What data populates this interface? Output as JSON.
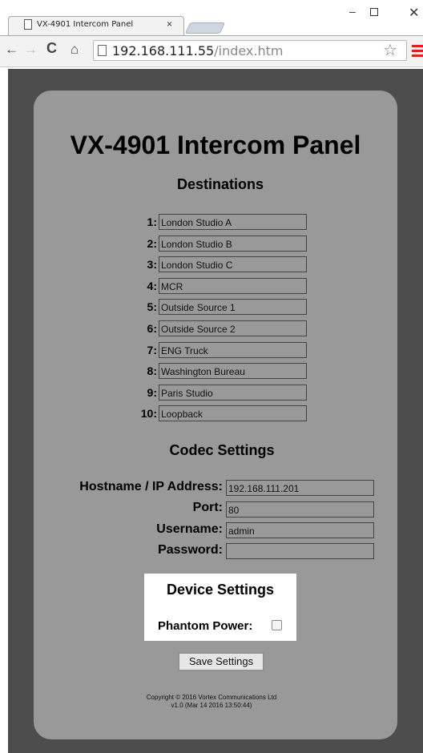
{
  "browser": {
    "tab_title": "VX-4901 Intercom Panel",
    "tab_close": "×",
    "url_host": "192.168.111.55",
    "url_path": "/index.htm"
  },
  "page": {
    "title": "VX-4901 Intercom Panel",
    "destinations_heading": "Destinations",
    "destinations": [
      {
        "num": "1:",
        "value": "London Studio A"
      },
      {
        "num": "2:",
        "value": "London Studio B"
      },
      {
        "num": "3:",
        "value": "London Studio C"
      },
      {
        "num": "4:",
        "value": "MCR"
      },
      {
        "num": "5:",
        "value": "Outside Source 1"
      },
      {
        "num": "6:",
        "value": "Outside Source 2"
      },
      {
        "num": "7:",
        "value": "ENG Truck"
      },
      {
        "num": "8:",
        "value": "Washington Bureau"
      },
      {
        "num": "9:",
        "value": "Paris Studio"
      },
      {
        "num": "10:",
        "value": "Loopback"
      }
    ],
    "codec_heading": "Codec Settings",
    "codec": {
      "hostname_label": "Hostname / IP Address:",
      "hostname_value": "192.168.111.201",
      "port_label": "Port:",
      "port_value": "80",
      "username_label": "Username:",
      "username_value": "admin",
      "password_label": "Password:",
      "password_value": ""
    },
    "device_heading": "Device Settings",
    "phantom_label": "Phantom Power:",
    "phantom_checked": false,
    "save_label": "Save Settings",
    "copyright": "Copyright © 2016 Vortex Communications Ltd",
    "version": "v1.0 (Mar 14 2016 13:50:44)"
  }
}
